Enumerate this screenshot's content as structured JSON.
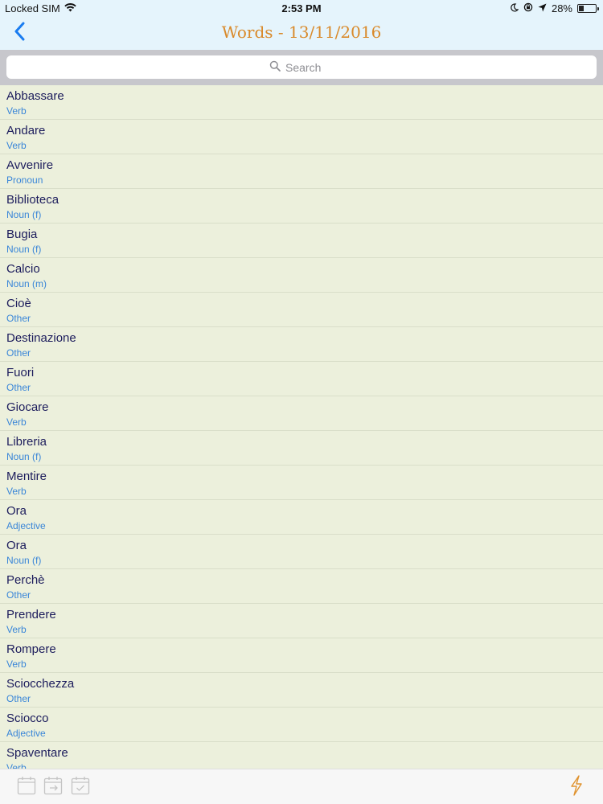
{
  "status": {
    "carrier": "Locked SIM",
    "time": "2:53 PM",
    "battery": "28%"
  },
  "nav": {
    "title": "Words - 13/11/2016"
  },
  "search": {
    "placeholder": "Search"
  },
  "words": [
    {
      "word": "Abbassare",
      "type": "Verb"
    },
    {
      "word": "Andare",
      "type": "Verb"
    },
    {
      "word": "Avvenire",
      "type": "Pronoun"
    },
    {
      "word": "Biblioteca",
      "type": "Noun (f)"
    },
    {
      "word": "Bugia",
      "type": "Noun (f)"
    },
    {
      "word": "Calcio",
      "type": "Noun (m)"
    },
    {
      "word": "Cioè",
      "type": "Other"
    },
    {
      "word": "Destinazione",
      "type": "Other"
    },
    {
      "word": "Fuori",
      "type": "Other"
    },
    {
      "word": "Giocare",
      "type": "Verb"
    },
    {
      "word": "Libreria",
      "type": "Noun (f)"
    },
    {
      "word": "Mentire",
      "type": "Verb"
    },
    {
      "word": "Ora",
      "type": "Adjective"
    },
    {
      "word": "Ora",
      "type": "Noun (f)"
    },
    {
      "word": "Perchè",
      "type": "Other"
    },
    {
      "word": "Prendere",
      "type": "Verb"
    },
    {
      "word": "Rompere",
      "type": "Verb"
    },
    {
      "word": "Sciocchezza",
      "type": "Other"
    },
    {
      "word": "Sciocco",
      "type": "Adjective"
    },
    {
      "word": "Spaventare",
      "type": "Verb"
    }
  ],
  "icons": {
    "back": "chevron-left-icon",
    "search": "search-icon",
    "toolbar": [
      "calendar-icon",
      "calendar-arrow-icon",
      "calendar-check-icon",
      "lightning-icon"
    ]
  },
  "colors": {
    "nav_background": "#e5f4fc",
    "title": "#d98a2b",
    "accent_blue": "#1a7cf0",
    "word_text": "#1c1c5c",
    "type_text": "#3a86d8",
    "list_background": "#ecf0dc"
  }
}
